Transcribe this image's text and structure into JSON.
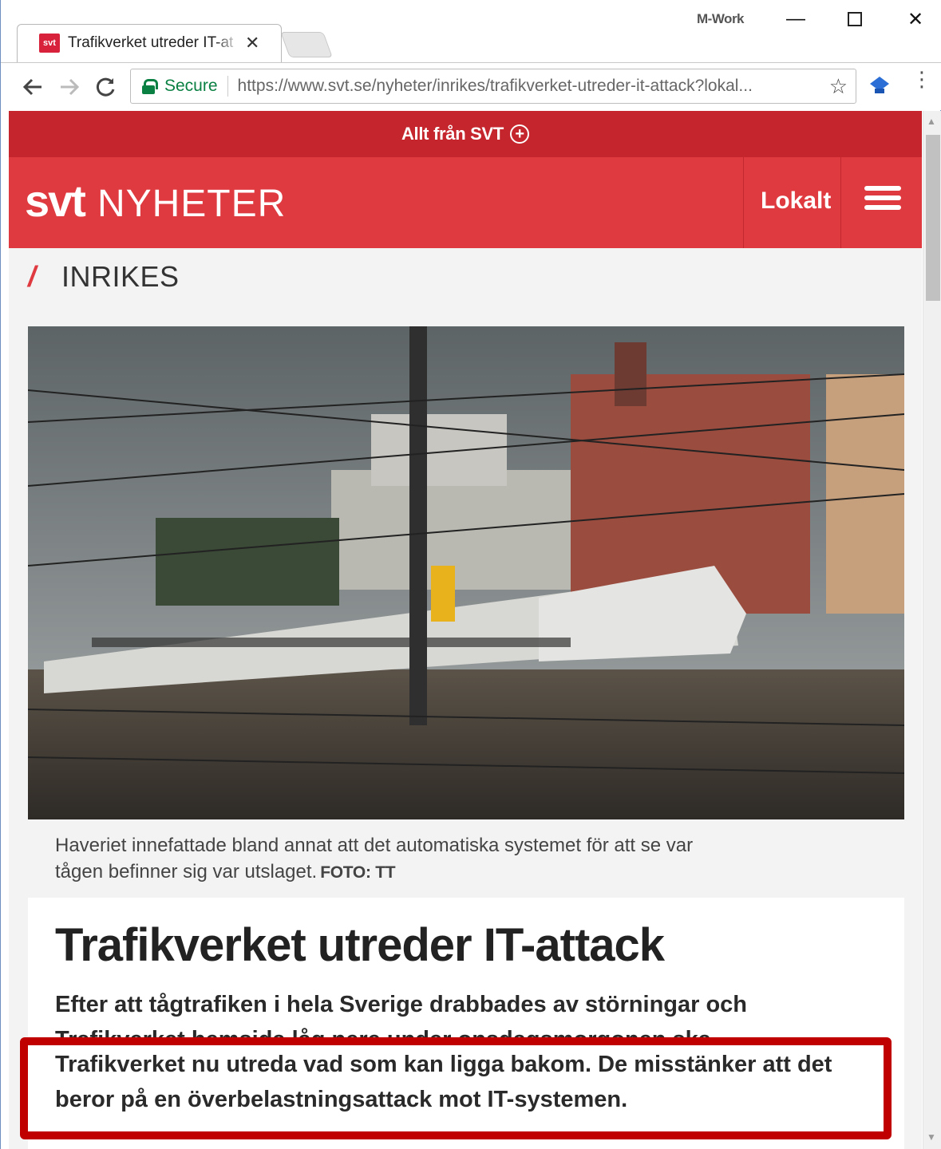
{
  "browser": {
    "tab_title": "Trafikverket utreder IT-at",
    "tab_favicon": "svt",
    "profile_name": "M-Work",
    "secure_label": "Secure",
    "url": "https://www.svt.se/nyheter/inrikes/trafikverket-utreder-it-attack?lokal...",
    "icons": [
      "back-arrow-icon",
      "forward-arrow-icon",
      "reload-icon",
      "lock-icon",
      "star-icon",
      "extension-icon",
      "menu-dots-icon",
      "close-icon",
      "minimize-icon",
      "maximize-icon"
    ]
  },
  "site": {
    "topbar_label": "Allt från SVT",
    "logo_svt": "svt",
    "logo_nyheter": "NYHETER",
    "nav_lokalt": "Lokalt",
    "section": "INRIKES",
    "brand_color": "#e03a41",
    "topbar_color": "#c5252c"
  },
  "article": {
    "caption": "Haveriet innefattade bland annat att det automatiska systemet för att se var tågen befinner sig var utslaget.",
    "caption_credit": "FOTO: TT",
    "headline": "Trafikverket utreder IT-attack",
    "lead_line1": "Efter att tågtrafiken i hela Sverige drabbades av störningar och",
    "lead_partial": "Trafikverket hemsida låg nere under onsdagsmorgonen ska",
    "lead_highlight": "Trafikverket nu utreda vad som kan ligga bakom. De misstänker att det beror på en överbelastningsattack mot IT-systemen."
  },
  "annotation": {
    "highlight_color": "#c00000"
  }
}
